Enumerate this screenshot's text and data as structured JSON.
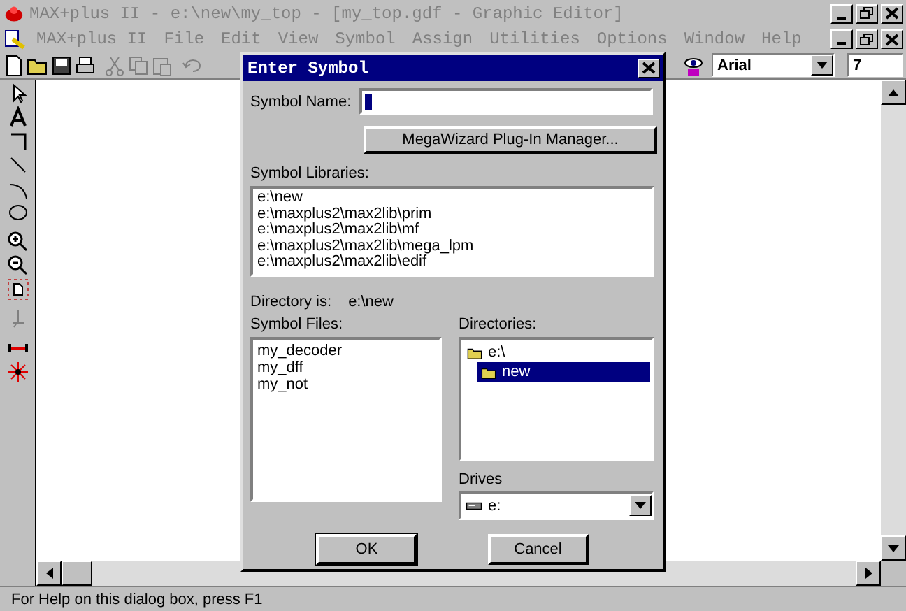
{
  "app_window": {
    "title": "MAX+plus II - e:\\new\\my_top - [my_top.gdf - Graphic Editor]"
  },
  "menu": [
    {
      "label": "MAX+plus II",
      "disabled": true
    },
    {
      "label": "File",
      "disabled": true
    },
    {
      "label": "Edit",
      "disabled": true
    },
    {
      "label": "View",
      "disabled": true
    },
    {
      "label": "Symbol",
      "disabled": true
    },
    {
      "label": "Assign",
      "disabled": true
    },
    {
      "label": "Utilities",
      "disabled": true
    },
    {
      "label": "Options",
      "disabled": true
    },
    {
      "label": "Window",
      "disabled": true
    },
    {
      "label": "Help",
      "disabled": true
    }
  ],
  "toolbar": {
    "font": "Arial",
    "font_size": "7"
  },
  "dialog": {
    "title": "Enter Symbol",
    "symbol_name_label": "Symbol Name:",
    "wizard_button": "MegaWizard Plug-In Manager...",
    "libraries_label": "Symbol Libraries:",
    "libraries": [
      "e:\\new",
      "e:\\maxplus2\\max2lib\\prim",
      "e:\\maxplus2\\max2lib\\mf",
      "e:\\maxplus2\\max2lib\\mega_lpm",
      "e:\\maxplus2\\max2lib\\edif"
    ],
    "directory_label": "Directory is:",
    "directory": "e:\\new",
    "files_label": "Symbol Files:",
    "files": [
      "my_decoder",
      "my_dff",
      "my_not"
    ],
    "directories_label": "Directories:",
    "directories": [
      {
        "name": "e:\\",
        "selected": false,
        "children": [
          {
            "name": "new",
            "selected": true
          }
        ]
      }
    ],
    "drives_label": "Drives",
    "drive": "e:",
    "buttons": [
      "OK",
      "Cancel"
    ]
  },
  "status_bar": "For Help on this dialog box, press F1"
}
